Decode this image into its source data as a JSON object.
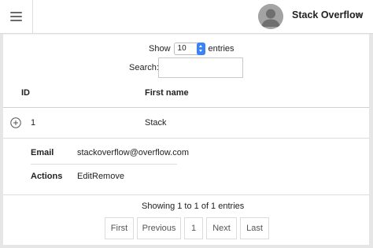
{
  "header": {
    "user_name": "Stack Overflow",
    "icons": [
      "hamburger-menu-icon",
      "avatar-icon",
      "chevron-down-icon"
    ]
  },
  "length": {
    "prefix": "Show",
    "value": "10",
    "suffix": "entries"
  },
  "search": {
    "label": "Search:",
    "value": ""
  },
  "table": {
    "columns": [
      "ID",
      "First name"
    ],
    "rows": [
      {
        "id": "1",
        "first_name": "Stack"
      }
    ],
    "detail": {
      "email_label": "Email",
      "email_value": "stackoverflow@overflow.com",
      "actions_label": "Actions",
      "edit": "Edit",
      "remove": "Remove"
    }
  },
  "info": "Showing 1 to 1 of 1 entries",
  "pagination": {
    "first": "First",
    "previous": "Previous",
    "page": "1",
    "next": "Next",
    "last": "Last"
  },
  "colors": {
    "accent": "#3b82f6",
    "border": "#dddddd",
    "frame": "#e6e6e6",
    "avatar": "#9b9b9b"
  }
}
